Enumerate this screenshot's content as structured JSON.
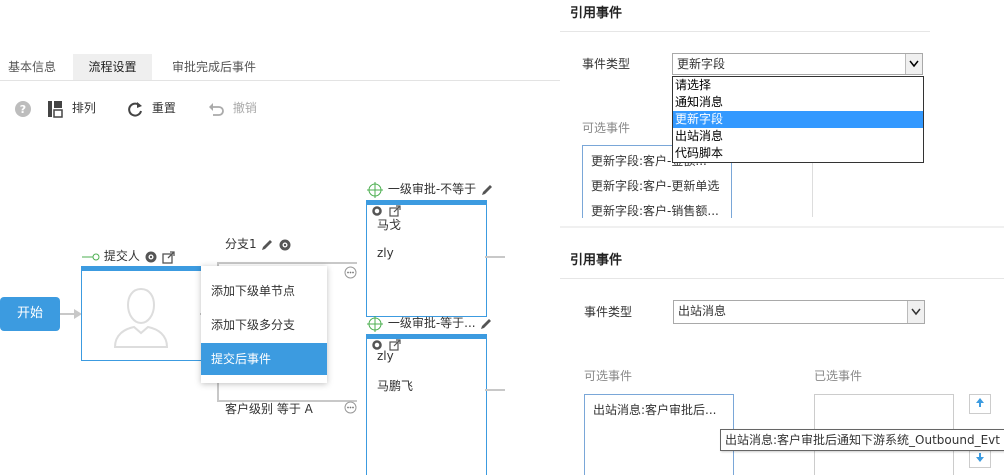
{
  "tabs": [
    {
      "label": "基本信息",
      "active": false
    },
    {
      "label": "流程设置",
      "active": true
    },
    {
      "label": "审批完成后事件",
      "active": false
    }
  ],
  "toolbar": {
    "arrange": "排列",
    "reset": "重置",
    "undo": "撤销"
  },
  "flow": {
    "start": "开始",
    "submitter_label": "提交人",
    "branch1_label": "分支1",
    "branch_bottom_label": "客户级别 等于 A",
    "approval1": {
      "title": "一级审批-不等于",
      "users": [
        "马戈",
        "zly"
      ]
    },
    "approval2": {
      "title": "一级审批-等于...",
      "users": [
        "zly",
        "马鹏飞"
      ]
    }
  },
  "context_menu": {
    "items": [
      "添加下级单节点",
      "添加下级多分支",
      "提交后事件"
    ],
    "highlighted_index": 2
  },
  "panel1": {
    "title": "引用事件",
    "event_type_label": "事件类型",
    "event_type_value": "更新字段",
    "options": [
      "请选择",
      "通知消息",
      "更新字段",
      "出站消息",
      "代码脚本"
    ],
    "selected_option_index": 2,
    "available_label": "可选事件",
    "available_items": [
      "更新字段:客户-金额...",
      "更新字段:客户-更新单选",
      "更新字段:客户-销售额..."
    ]
  },
  "panel2": {
    "title": "引用事件",
    "event_type_label": "事件类型",
    "event_type_value": "出站消息",
    "available_label": "可选事件",
    "selected_label": "已选事件",
    "available_items": [
      "出站消息:客户审批后..."
    ],
    "tooltip": "出站消息:客户审批后通知下游系统_Outbound_Evt"
  },
  "colors": {
    "accent": "#3c9be0",
    "highlight": "#3399ff"
  }
}
